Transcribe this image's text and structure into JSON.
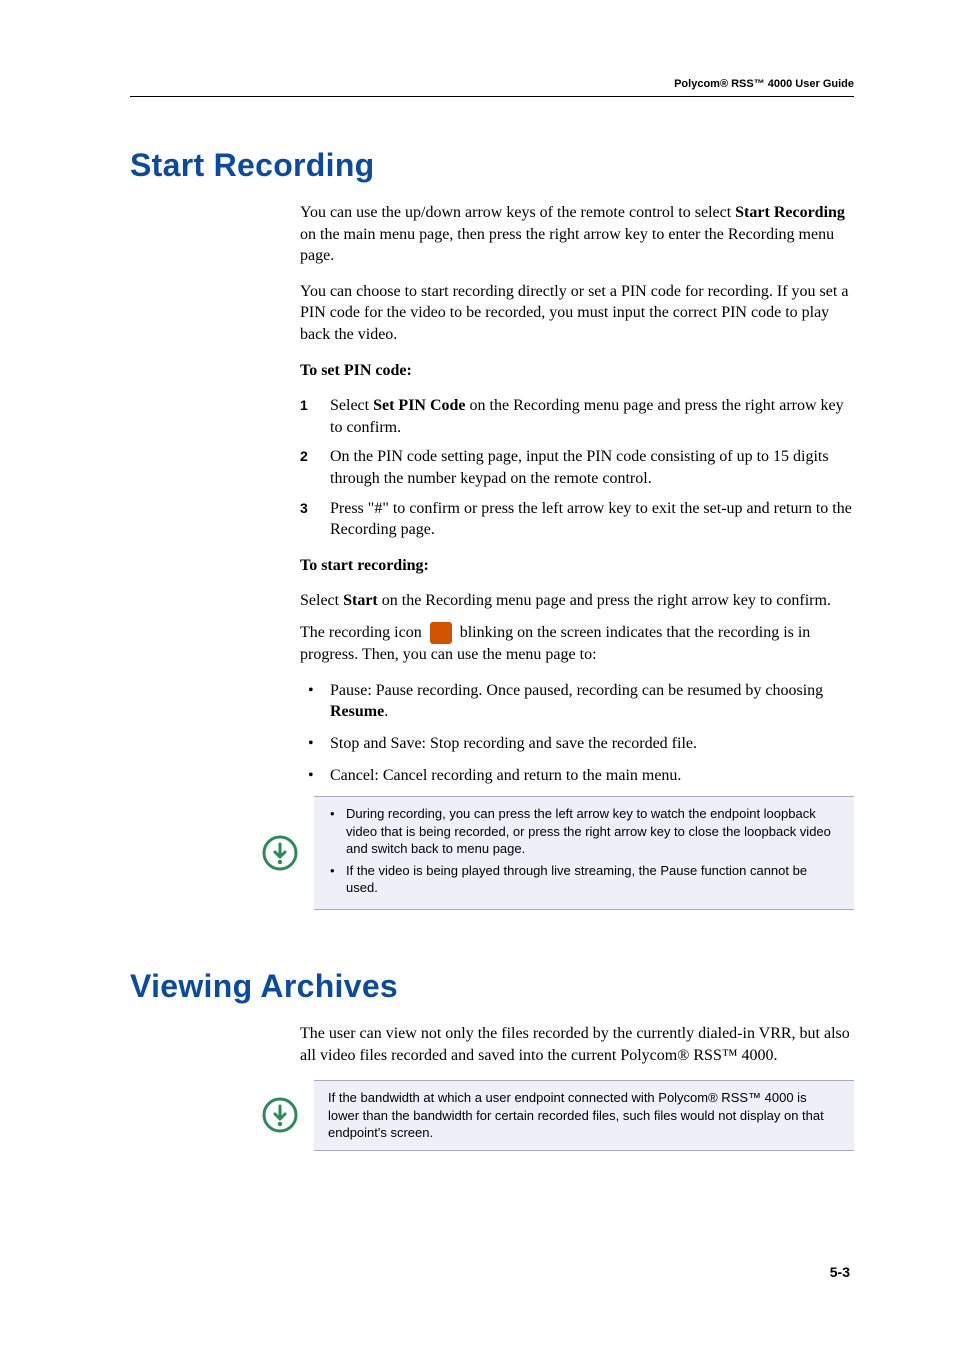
{
  "header": {
    "title": "Polycom® RSS™ 4000 User Guide"
  },
  "section1": {
    "heading": "Start Recording",
    "intro1_a": "You can use the up/down arrow keys of the remote control to select ",
    "intro1_b": "Start Recording",
    "intro1_c": " on the main menu page, then press the right arrow key to enter the Recording menu page.",
    "intro2": "You can choose to start recording directly or set a PIN code for recording. If you set a PIN code for the video to be recorded, you must input the correct PIN code to play back the video.",
    "pin_head": "To set PIN code:",
    "steps": [
      {
        "n": "1",
        "pre": "Select ",
        "bold": "Set PIN Code",
        "post": " on the Recording menu page and press the right arrow key to confirm."
      },
      {
        "n": "2",
        "pre": "On the PIN code setting page, input the PIN code consisting of up to 15 digits through the number keypad on the remote control.",
        "bold": "",
        "post": ""
      },
      {
        "n": "3",
        "pre": "Press \"#\" to confirm or press the left arrow key to exit the set-up and return to the Recording page.",
        "bold": "",
        "post": ""
      }
    ],
    "start_head": "To start recording:",
    "start_p_a": "Select ",
    "start_p_b": "Start",
    "start_p_c": " on the Recording menu page and press the right arrow key to confirm.",
    "rec_a": "The recording icon ",
    "rec_b": " blinking on the screen indicates that the recording is in progress. Then, you can use the menu page to:",
    "actions": [
      {
        "pre": "Pause: Pause recording. Once paused, recording can be resumed by choosing ",
        "bold": "Resume",
        "post": "."
      },
      {
        "pre": "Stop and Save: Stop recording and save the recorded file.",
        "bold": "",
        "post": ""
      },
      {
        "pre": "Cancel: Cancel recording and return to the main menu.",
        "bold": "",
        "post": ""
      }
    ],
    "note": [
      "During recording, you can press the left arrow key to watch the endpoint loopback video that is being recorded, or press the right arrow key to close the loopback video and switch back to menu page.",
      "If the video is being played through live streaming, the Pause function cannot be used."
    ]
  },
  "section2": {
    "heading": "Viewing Archives",
    "intro": "The user can view not only the files recorded by the currently dialed-in VRR, but also all video files recorded and saved into the current Polycom® RSS™ 4000.",
    "note": "If the bandwidth at which a user endpoint connected with Polycom® RSS™ 4000 is lower than the bandwidth for certain recorded files, such files would not display on that endpoint's screen."
  },
  "footer": {
    "page_num": "5-3"
  },
  "colors": {
    "heading_blue": "#0b4aa2",
    "note_bg": "#eef0f7",
    "rec_icon": "#d35400"
  }
}
